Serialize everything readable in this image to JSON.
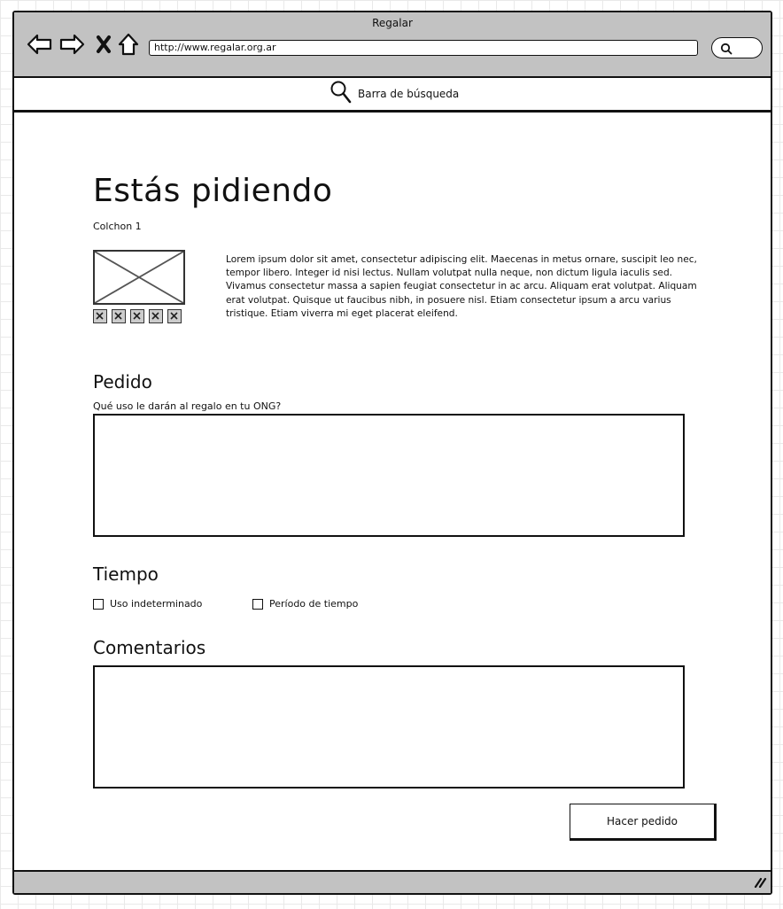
{
  "window": {
    "title": "Regalar"
  },
  "toolbar": {
    "url": "http://www.regalar.org.ar"
  },
  "searchbar": {
    "label": "Barra de búsqueda"
  },
  "main": {
    "title": "Estás pidiendo",
    "item_name": "Colchon 1",
    "thumbnail_count": 5,
    "description": "Lorem ipsum dolor sit amet, consectetur adipiscing elit. Maecenas in metus ornare, suscipit leo nec, tempor libero. Integer id nisi lectus. Nullam volutpat nulla neque, non dictum ligula iaculis sed. Vivamus consectetur massa a sapien feugiat consectetur in ac arcu. Aliquam erat volutpat. Aliquam erat volutpat. Quisque ut faucibus nibh, in posuere nisl. Etiam consectetur ipsum a arcu varius tristique. Etiam viverra mi eget placerat eleifend."
  },
  "pedido": {
    "title": "Pedido",
    "question": "Qué uso le darán al regalo en tu ONG?",
    "value": ""
  },
  "tiempo": {
    "title": "Tiempo",
    "options": [
      {
        "label": "Uso indeterminado",
        "checked": false
      },
      {
        "label": "Período de tiempo",
        "checked": false
      }
    ]
  },
  "comentarios": {
    "title": "Comentarios",
    "value": ""
  },
  "actions": {
    "submit_label": "Hacer pedido"
  }
}
